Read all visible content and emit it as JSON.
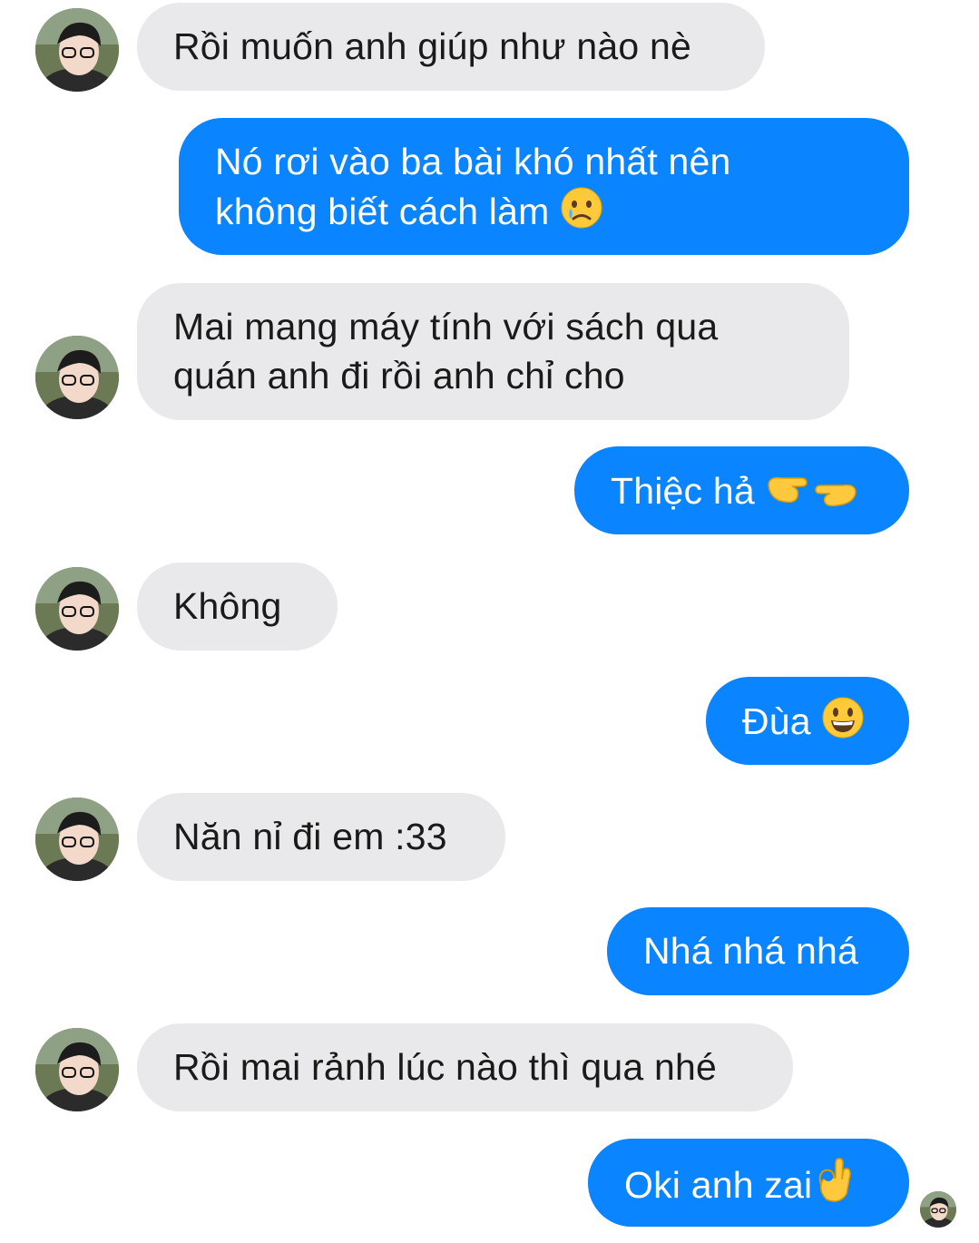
{
  "conversation": {
    "messages": [
      {
        "from": "other",
        "text": "Rồi muốn anh giúp như nào nè"
      },
      {
        "from": "me",
        "lines": [
          "Nó rơi vào ba bài khó nhất nên",
          "không biết cách làm"
        ],
        "emoji": "crying-face"
      },
      {
        "from": "other",
        "lines": [
          "Mai mang máy tính với sách qua",
          "quán anh đi rồi anh chỉ cho"
        ]
      },
      {
        "from": "me",
        "text": "Thiệc hả",
        "emoji": "fingers-pointing-together"
      },
      {
        "from": "other",
        "text": "Không"
      },
      {
        "from": "me",
        "text": "Đùa",
        "emoji": "grinning-face"
      },
      {
        "from": "other",
        "text": "Năn nỉ đi em :33"
      },
      {
        "from": "me",
        "text": "Nhá nhá nhá"
      },
      {
        "from": "other",
        "text": "Rồi mai rảnh lúc nào thì qua nhé"
      },
      {
        "from": "me",
        "text": "Oki anh zai",
        "emoji": "ok-hand"
      }
    ]
  },
  "colors": {
    "sent_bubble": "#0a84ff",
    "received_bubble": "#e9e9eb",
    "sent_text": "#ffffff",
    "received_text": "#1a1a1a"
  },
  "icons": {
    "avatar": "contact-avatar-photo",
    "seen_indicator": "seen-avatar-small"
  }
}
